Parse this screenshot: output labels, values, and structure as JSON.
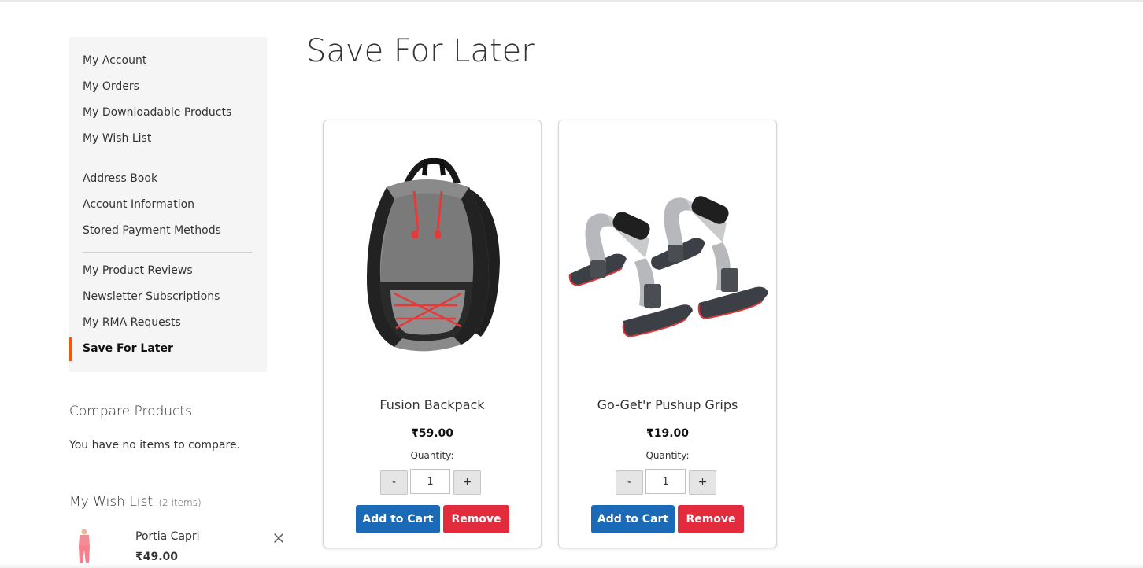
{
  "sidebar": {
    "group1": [
      "My Account",
      "My Orders",
      "My Downloadable Products",
      "My Wish List"
    ],
    "group2": [
      "Address Book",
      "Account Information",
      "Stored Payment Methods"
    ],
    "group3": [
      "My Product Reviews",
      "Newsletter Subscriptions",
      "My RMA Requests"
    ],
    "active": "Save For Later",
    "active_accent": "#ff5501"
  },
  "compare": {
    "title": "Compare Products",
    "empty_text": "You have no items to compare."
  },
  "wishlist": {
    "title": "My Wish List",
    "count": "(2 items)",
    "item": {
      "name": "Portia Capri",
      "price": "₹49.00",
      "icon": "close-icon"
    }
  },
  "page": {
    "title": "Save For Later"
  },
  "quantity_label": "Quantity:",
  "products": [
    {
      "name": "Fusion Backpack",
      "price": "₹59.00",
      "qty": "1",
      "minus": "-",
      "plus": "+",
      "add_label": "Add to Cart",
      "remove_label": "Remove"
    },
    {
      "name": "Go-Get'r Pushup Grips",
      "price": "₹19.00",
      "qty": "1",
      "minus": "-",
      "plus": "+",
      "add_label": "Add to Cart",
      "remove_label": "Remove"
    }
  ],
  "colors": {
    "add_to_cart": "#1a6ab8",
    "remove": "#e22b3c"
  }
}
